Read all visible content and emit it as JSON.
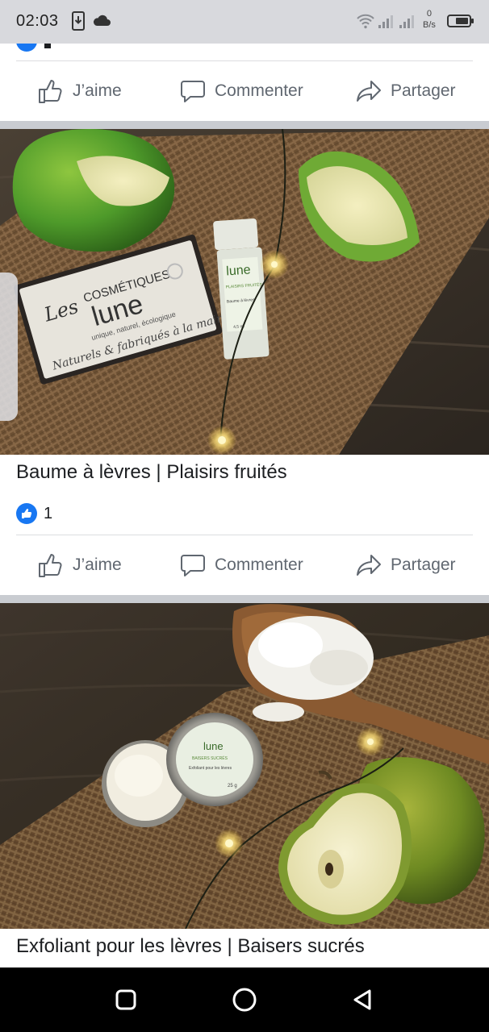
{
  "status_bar": {
    "time": "02:03",
    "net_speed_value": "0",
    "net_speed_unit": "B/s"
  },
  "actions": {
    "like": "J’aime",
    "comment": "Commenter",
    "share": "Partager"
  },
  "posts": [
    {
      "title": "Baume à lèvres | Plaisirs fruités",
      "like_count": "1",
      "photo": {
        "box_brand_small": "Les",
        "box_brand_line1": "COSMÉTIQUES",
        "box_brand_line2": "lune",
        "box_tagline": "unique, naturel, écologique",
        "box_bottom": "Naturels & fabriqués à la main",
        "tube_brand": "lune",
        "tube_flavor": "PLAISIRS FRUITÉS",
        "tube_product": "Baume à lèvres",
        "tube_volume": "4,5 ml"
      }
    },
    {
      "title": "Exfoliant pour les lèvres | Baisers sucrés",
      "photo": {
        "lid_brand": "lune",
        "lid_flavor": "BAISERS SUCRÉS",
        "lid_product": "Exfoliant pour les lèvres",
        "lid_weight": "25 g"
      }
    }
  ],
  "navigation": {
    "recent": "recent-apps-icon",
    "home": "home-icon",
    "back": "back-icon"
  },
  "colors": {
    "facebook_blue": "#1877f2",
    "action_gray": "#606770",
    "separator": "#c9ccd1",
    "status_bar_bg": "#d8d9dd"
  }
}
